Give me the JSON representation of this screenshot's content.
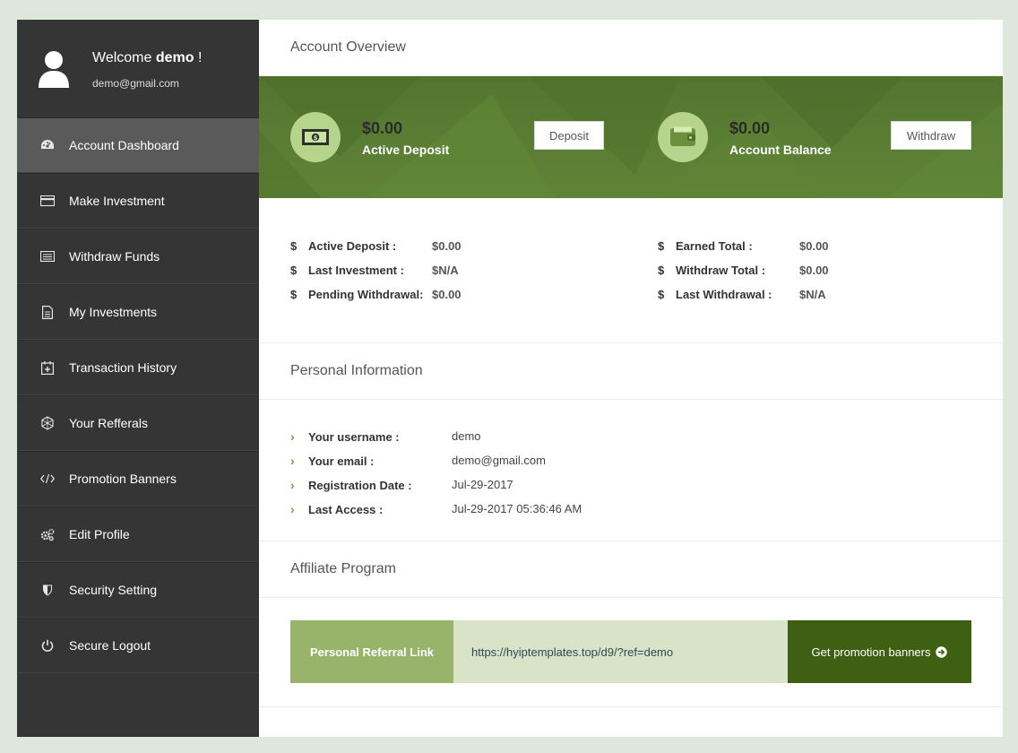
{
  "sidebar": {
    "welcome_prefix": "Welcome",
    "username": "demo",
    "welcome_suffix": "!",
    "email": "demo@gmail.com",
    "items": [
      {
        "label": "Account Dashboard",
        "icon": "dashboard-icon",
        "active": true
      },
      {
        "label": "Make Investment",
        "icon": "credit-card-icon"
      },
      {
        "label": "Withdraw Funds",
        "icon": "list-icon"
      },
      {
        "label": "My Investments",
        "icon": "document-icon"
      },
      {
        "label": "Transaction History",
        "icon": "calendar-plus-icon"
      },
      {
        "label": "Your Refferals",
        "icon": "network-icon"
      },
      {
        "label": "Promotion Banners",
        "icon": "code-icon"
      },
      {
        "label": "Edit Profile",
        "icon": "gears-icon"
      },
      {
        "label": "Security Setting",
        "icon": "shield-icon"
      },
      {
        "label": "Secure Logout",
        "icon": "power-icon"
      }
    ]
  },
  "overview": {
    "title": "Account Overview",
    "active_deposit": {
      "amount": "$0.00",
      "label": "Active Deposit",
      "button": "Deposit"
    },
    "account_balance": {
      "amount": "$0.00",
      "label": "Account Balance",
      "button": "Withdraw"
    }
  },
  "summary": {
    "currency_symbol": "$",
    "left": [
      {
        "label": "Active Deposit :",
        "value": "$0.00"
      },
      {
        "label": "Last Investment :",
        "value": "$N/A"
      },
      {
        "label": "Pending Withdrawal:",
        "value": "$0.00"
      }
    ],
    "right": [
      {
        "label": "Earned Total :",
        "value": "$0.00"
      },
      {
        "label": "Withdraw Total :",
        "value": "$0.00"
      },
      {
        "label": "Last Withdrawal :",
        "value": "$N/A"
      }
    ]
  },
  "personal": {
    "title": "Personal Information",
    "rows": [
      {
        "label": "Your username :",
        "value": "demo"
      },
      {
        "label": "Your email :",
        "value": "demo@gmail.com"
      },
      {
        "label": "Registration Date :",
        "value": "Jul-29-2017"
      },
      {
        "label": "Last Access :",
        "value": "Jul-29-2017 05:36:46 AM"
      }
    ]
  },
  "affiliate": {
    "title": "Affiliate Program",
    "link_label": "Personal Referral Link",
    "link_url": "https://hyiptemplates.top/d9/?ref=demo",
    "button_label": "Get promotion banners"
  },
  "colors": {
    "sidebar_bg": "#353535",
    "active_item": "#5a5a5a",
    "banner_green": "#5b7e35",
    "accent_light": "#b6d48b",
    "ref_dark": "#3f5f12"
  }
}
